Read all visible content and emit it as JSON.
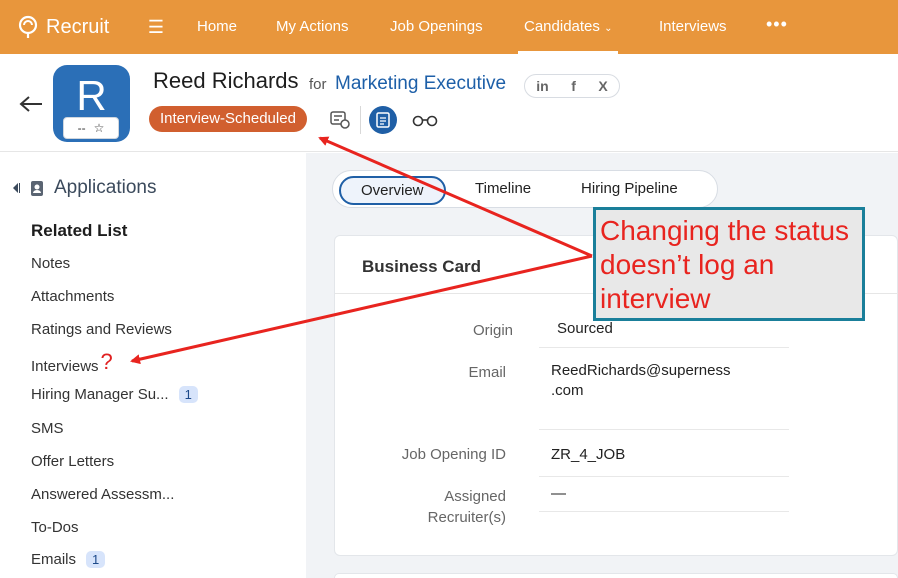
{
  "nav": {
    "brand": "Recruit",
    "items": [
      {
        "label": "Home"
      },
      {
        "label": "My Actions"
      },
      {
        "label": "Job Openings"
      },
      {
        "label": "Candidates"
      },
      {
        "label": "Interviews"
      }
    ],
    "more_icon": "more-dots-icon"
  },
  "header": {
    "avatar_letter": "R",
    "rating_text": "--",
    "name": "Reed Richards",
    "for_word": "for",
    "job": "Marketing Executive",
    "social": [
      "in",
      "f",
      "X"
    ],
    "status": "Interview-Scheduled",
    "colors": {
      "status": "#d15f2f",
      "brand": "#e8963c",
      "link": "#1d5fa8"
    }
  },
  "sidebar": {
    "applications": "Applications",
    "related_title": "Related List",
    "items": [
      {
        "label": "Notes",
        "badge": null
      },
      {
        "label": "Attachments",
        "badge": null
      },
      {
        "label": "Ratings and Reviews",
        "badge": null
      },
      {
        "label": "Interviews",
        "badge": null
      },
      {
        "label": "Hiring Manager Su...",
        "badge": "1"
      },
      {
        "label": "SMS",
        "badge": null
      },
      {
        "label": "Offer Letters",
        "badge": null
      },
      {
        "label": "Answered Assessm...",
        "badge": null
      },
      {
        "label": "To-Dos",
        "badge": null
      },
      {
        "label": "Emails",
        "badge": "1"
      }
    ],
    "question_mark": "?"
  },
  "tabs": [
    {
      "label": "Overview"
    },
    {
      "label": "Timeline"
    },
    {
      "label": "Hiring Pipeline"
    }
  ],
  "card": {
    "title": "Business Card",
    "fields": [
      {
        "label": "Origin",
        "value": "Sourced"
      },
      {
        "label": "Email",
        "value": "ReedRichards@superness\n.com"
      },
      {
        "label": "Job Opening ID",
        "value": "ZR_4_JOB"
      },
      {
        "label": "Assigned\nRecruiter(s)",
        "value": "—"
      }
    ]
  },
  "annotation": {
    "text": "Changing the status doesn’t log an interview",
    "color": "#e8241f"
  }
}
